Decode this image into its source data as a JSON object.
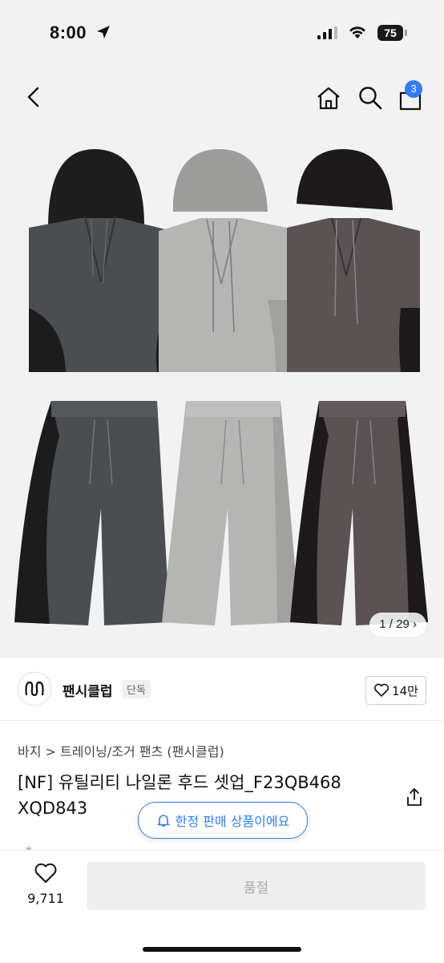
{
  "status_bar": {
    "time": "8:00",
    "battery": "75"
  },
  "header": {
    "cart_count": "3"
  },
  "gallery": {
    "counter": "1 / 29 ›"
  },
  "seller": {
    "name": "팬시클럽",
    "tag": "단독",
    "likes": "14만"
  },
  "product": {
    "breadcrumb": "바지 > 트레이닝/조거 팬츠 (팬시클럽)",
    "title": "[NF] 유틸리티 나일론 후드 셋업_F23QB468 XQD843"
  },
  "toast": {
    "text": "한정 판매 상품이에요"
  },
  "bottom": {
    "wish_count": "9,711",
    "buy_label": "품절"
  },
  "colors": {
    "accent": "#2f7cf6",
    "vest_dark": "#4b4f52",
    "vest_light": "#b4b5b4",
    "vest_brown": "#5a5253"
  }
}
